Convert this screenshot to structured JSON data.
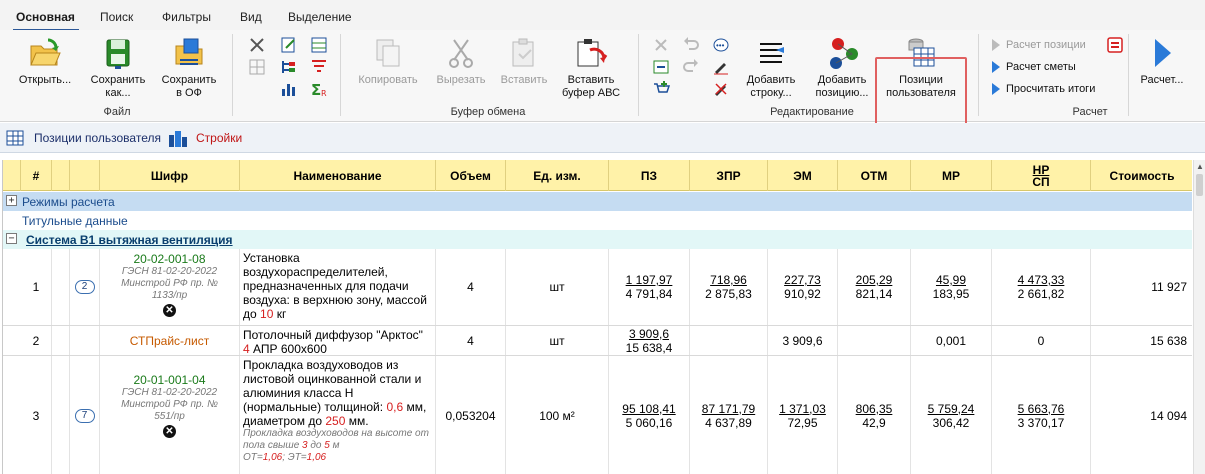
{
  "ribbon_tabs": [
    "Основная",
    "Поиск",
    "Фильтры",
    "Вид",
    "Выделение"
  ],
  "ribbon": {
    "file_group": {
      "label": "Файл",
      "open": "Открыть...",
      "save_as_1": "Сохранить",
      "save_as_2": "как...",
      "save_of_1": "Сохранить",
      "save_of_2": "в ОФ"
    },
    "clipboard_group": {
      "label": "Буфер обмена",
      "copy": "Копировать",
      "cut": "Вырезать",
      "paste": "Вставить",
      "paste_abc_1": "Вставить",
      "paste_abc_2": "буфер АВС"
    },
    "edit_group": {
      "label": "Редактирование",
      "add_row_1": "Добавить",
      "add_row_2": "строку...",
      "add_pos_1": "Добавить",
      "add_pos_2": "позицию...",
      "user_pos_1": "Позиции",
      "user_pos_2": "пользователя"
    },
    "calc_group": {
      "label": "Расчет",
      "calc_position": "Расчет позиции",
      "calc_estimate": "Расчет сметы",
      "recalc_totals": "Просчитать итоги",
      "calc": "Расчет..."
    }
  },
  "subbar": {
    "user_positions": "Позиции пользователя",
    "buildings": "Стройки"
  },
  "columns": {
    "num": "#",
    "code": "Шифр",
    "name": "Наименование",
    "volume": "Объем",
    "unit": "Ед. изм.",
    "pz": "ПЗ",
    "zpr": "ЗПР",
    "em": "ЭМ",
    "otm": "ОТМ",
    "mr": "МР",
    "nr": "НР",
    "sp": "СП",
    "cost": "Стоимость"
  },
  "bands": {
    "calc_modes": "Режимы расчета",
    "title_data": "Титульные данные",
    "section": "Система В1 вытяжная вентиляция"
  },
  "rows": [
    {
      "num": "1",
      "badge": "2",
      "code": "20-02-001-08",
      "source_1": "ГЭСН 81-02-20-2022",
      "source_2": "Минстрой РФ пр. №",
      "source_3": "1133/пр",
      "name_a": "Установка воздухораспределителей, предназначенных для подачи воздуха: в верхнюю зону, массой до ",
      "name_b": "10",
      "name_c": " кг",
      "volume": "4",
      "unit": "шт",
      "pz_top": "1 197,97",
      "pz_bot": "4 791,84",
      "zpr_top": "718,96",
      "zpr_bot": "2 875,83",
      "em_top": "227,73",
      "em_bot": "910,92",
      "otm_top": "205,29",
      "otm_bot": "821,14",
      "mr_top": "45,99",
      "mr_bot": "183,95",
      "nr_top": "4 473,33",
      "nr_bot": "2 661,82",
      "cost": "11 927"
    },
    {
      "num": "2",
      "code": "СТПрайс-лист",
      "name_a": "Потолочный диффузор \"Арктос\" ",
      "name_b": "4",
      "name_c": " АПР 600х600",
      "volume": "4",
      "unit": "шт",
      "pz_top": "3 909,6",
      "pz_bot": "15 638,4",
      "em": "3 909,6",
      "mr": "0,001",
      "nr": "0",
      "cost": "15 638"
    },
    {
      "num": "3",
      "badge": "7",
      "code": "20-01-001-04",
      "source_1": "ГЭСН 81-02-20-2022",
      "source_2": "Минстрой РФ пр. №",
      "source_3": "551/пр",
      "name_a": "Прокладка воздуховодов из листовой оцинкованной стали и алюминия класса Н (нормальные) толщиной: ",
      "name_b": "0,6",
      "name_c": " мм, диаметром до ",
      "name_d": "250",
      "name_e": " мм.",
      "note_a": "Прокладка воздуховодов на высоте от пола свыше ",
      "note_b": "3",
      "note_c": " до ",
      "note_d": "5",
      "note_e": " м",
      "note_f": "ОТ=",
      "note_g": "1,06",
      "note_h": "; ЭТ=",
      "note_i": "1,06",
      "volume": "0,053204",
      "unit": "100 м²",
      "pz_top": "95 108,41",
      "pz_bot": "5 060,16",
      "zpr_top": "87 171,79",
      "zpr_bot": "4 637,89",
      "em_top": "1 371,03",
      "em_bot": "72,95",
      "otm_top": "806,35",
      "otm_bot": "42,9",
      "mr_top": "5 759,24",
      "mr_bot": "306,42",
      "nr_top": "5 663,76",
      "nr_bot": "3 370,17",
      "cost": "14 094"
    }
  ],
  "colors": {
    "header_bg": "#fff2a8",
    "band_blue": "#c5dcf2",
    "band_cyan": "#e2f7f7",
    "accent": "#2b5797",
    "highlight": "#e06060"
  }
}
